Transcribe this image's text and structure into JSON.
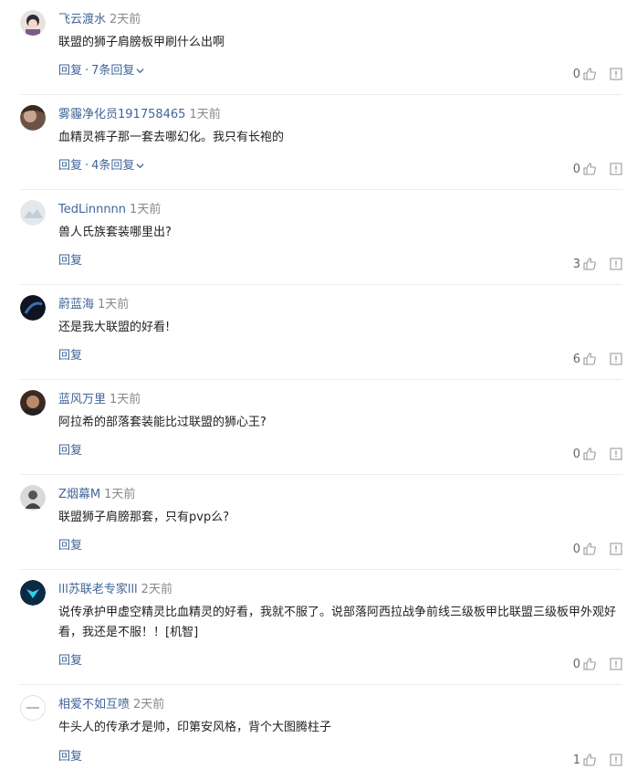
{
  "reply_label": "回复",
  "comments": [
    {
      "name": "飞云渡水",
      "time": "2天前",
      "text": "联盟的狮子肩膀板甲刷什么出啊",
      "replies": "7条回复",
      "likes": "0"
    },
    {
      "name": "雾霾净化员191758465",
      "time": "1天前",
      "text": "血精灵裤子那一套去哪幻化。我只有长袍的",
      "replies": "4条回复",
      "likes": "0"
    },
    {
      "name": "TedLinnnnn",
      "time": "1天前",
      "text": "兽人氏族套装哪里出?",
      "likes": "3"
    },
    {
      "name": "蔚蓝海",
      "time": "1天前",
      "text": "还是我大联盟的好看!",
      "likes": "6"
    },
    {
      "name": "蓝风万里",
      "time": "1天前",
      "text": "阿拉希的部落套装能比过联盟的狮心王?",
      "likes": "0"
    },
    {
      "name": "Z烟幕M",
      "time": "1天前",
      "text": "联盟狮子肩膀那套，只有pvp么?",
      "likes": "0"
    },
    {
      "name": "lll苏联老专家lll",
      "time": "2天前",
      "text": "说传承护甲虚空精灵比血精灵的好看，我就不服了。说部落阿西拉战争前线三级板甲比联盟三级板甲外观好看，我还是不服！！[机智]",
      "likes": "0"
    },
    {
      "name": "相爱不如互喷",
      "time": "2天前",
      "text": "牛头人的传承才是帅，印第安风格，背个大图腾柱子",
      "likes": "1"
    }
  ]
}
